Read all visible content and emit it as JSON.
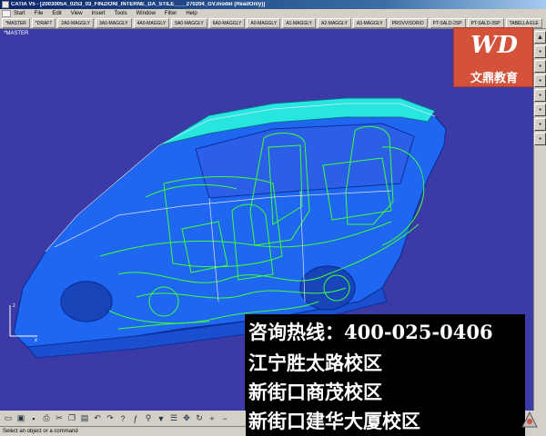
{
  "window": {
    "title": "CATIA V5 - [2003005A_0253_03_FINZIONI_INTERNE_DA_STILE____270204_GV.model (ReadOnly)]"
  },
  "menu": [
    "Start",
    "File",
    "Edit",
    "View",
    "Insert",
    "Tools",
    "Window",
    "Filter",
    "Help"
  ],
  "layers": [
    "*MASTER",
    "*DRAFT",
    "2A0-MAGGLY",
    "3A0-MAGGLY",
    "4A0-MAGGLY",
    "5A0-MAGGLY",
    "6A0-MAGGLY",
    "A0-MAGGLY",
    "A1-MAGGLY",
    "A2-MAGGLY",
    "A3-MAGGLY",
    "PROVVISORIO",
    "PT-SALD-2SP",
    "PT-SALD-3SP",
    "TABELLA ELE"
  ],
  "viewport": {
    "label": "*MASTER",
    "background": "#3c3aa6",
    "body_color": "#1f66f0",
    "roof_color": "#27e6e0",
    "wire_color": "#3cff3c"
  },
  "axis": {
    "z": "z",
    "x": "x"
  },
  "logo": {
    "mark": "WD",
    "name": "文鼎教育",
    "color": "#d4523a"
  },
  "ad": {
    "lines": [
      "咨询热线：400-025-0406",
      "江宁胜太路校区",
      "新街口商茂校区",
      "新街口建华大厦校区"
    ]
  },
  "toolbar": {
    "icons": [
      "new-icon",
      "open-icon",
      "save-icon",
      "print-icon",
      "cut-icon",
      "copy-icon",
      "paste-icon",
      "undo-icon",
      "redo-icon",
      "help-icon",
      "formula-icon",
      "search-icon",
      "filter-icon",
      "tree-icon",
      "pan-icon",
      "rotate-icon",
      "zoom-in-icon",
      "zoom-out-icon"
    ]
  },
  "status": {
    "text": "Select an object or a command"
  }
}
